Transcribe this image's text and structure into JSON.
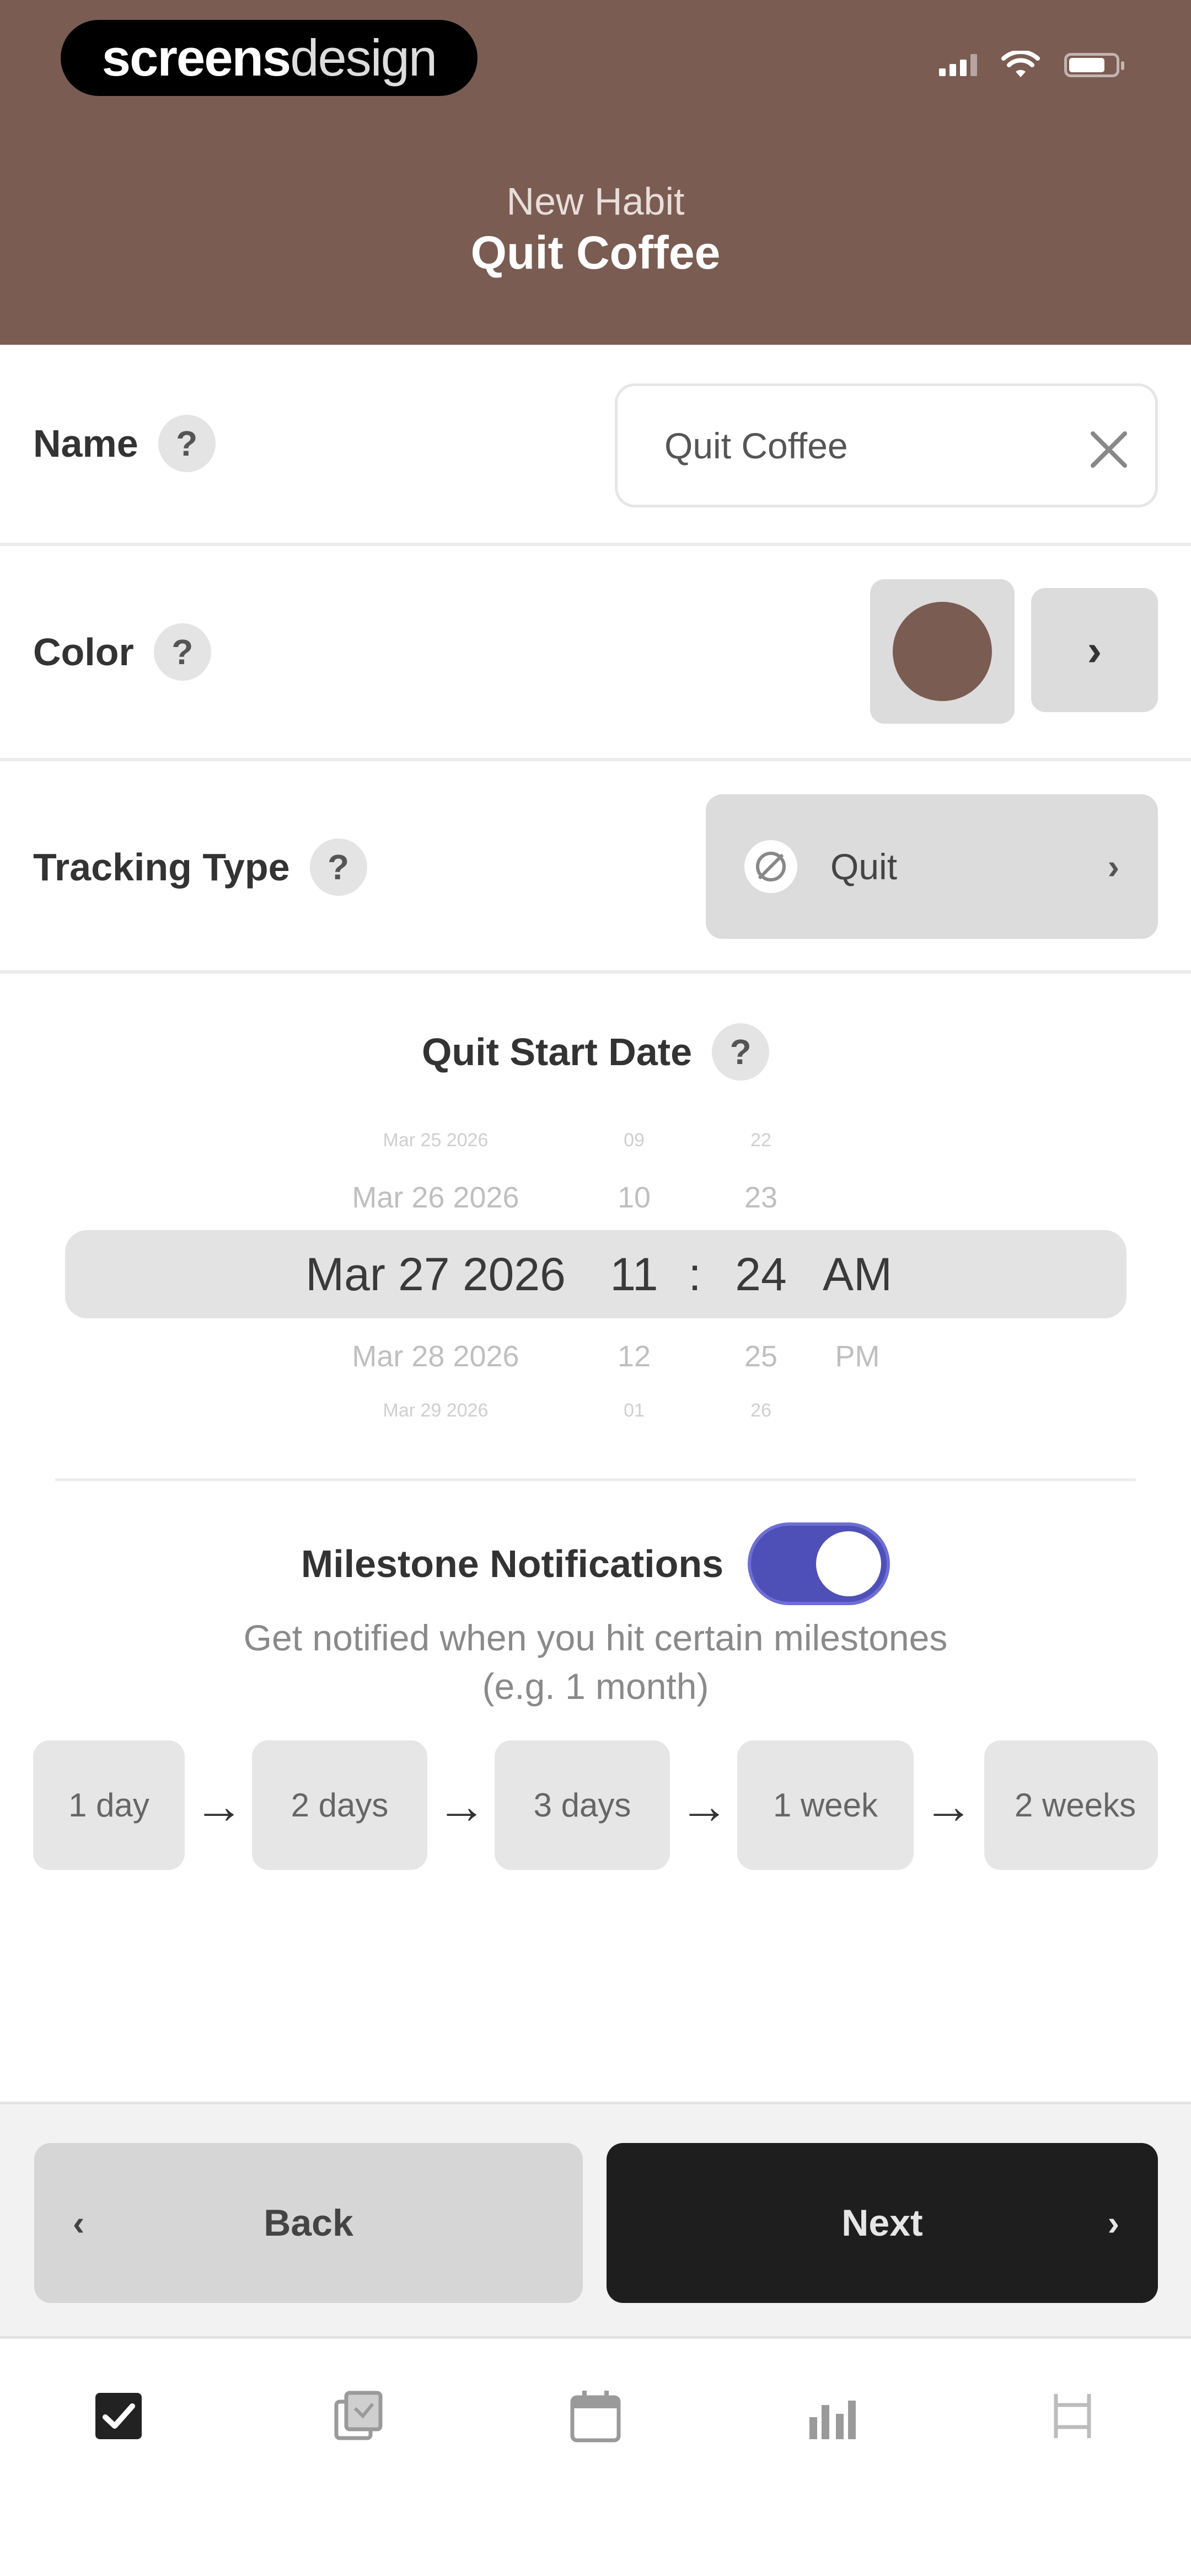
{
  "status_bar": {
    "brand_primary": "screens",
    "brand_secondary": "design"
  },
  "header": {
    "subtitle": "New Habit",
    "title": "Quit Coffee",
    "background_color": "#7a5c53"
  },
  "form": {
    "name": {
      "label": "Name",
      "help": "?",
      "value": "Quit Coffee"
    },
    "color": {
      "label": "Color",
      "help": "?",
      "selected_color": "#7a5c53",
      "chevron": "›"
    },
    "tracking_type": {
      "label": "Tracking Type",
      "help": "?",
      "value": "Quit",
      "chevron": "›"
    }
  },
  "quit_start_date": {
    "title": "Quit Start Date",
    "help": "?",
    "picker": {
      "rows": [
        {
          "date": "Mar 25 2026",
          "hour": "09",
          "minute": "22",
          "period": ""
        },
        {
          "date": "Mar 26 2026",
          "hour": "10",
          "minute": "23",
          "period": ""
        },
        {
          "date": "Mar 27 2026",
          "hour": "11",
          "minute": "24",
          "period": "AM"
        },
        {
          "date": "Mar 28 2026",
          "hour": "12",
          "minute": "25",
          "period": "PM"
        },
        {
          "date": "Mar 29 2026",
          "hour": "01",
          "minute": "26",
          "period": ""
        }
      ],
      "separator": ":"
    }
  },
  "milestones": {
    "title": "Milestone Notifications",
    "enabled": true,
    "toggle_color": "#4f4fb8",
    "description_line1": "Get notified when you hit certain milestones",
    "description_line2": "(e.g. 1 month)",
    "items": [
      "1 day",
      "2 days",
      "3 days",
      "1 week",
      "2 weeks"
    ]
  },
  "actions": {
    "back_label": "Back",
    "next_label": "Next"
  },
  "tab_bar": {
    "tabs": [
      "checkbox-icon",
      "notes-icon",
      "calendar-icon",
      "stats-icon",
      "settings-icon"
    ]
  }
}
